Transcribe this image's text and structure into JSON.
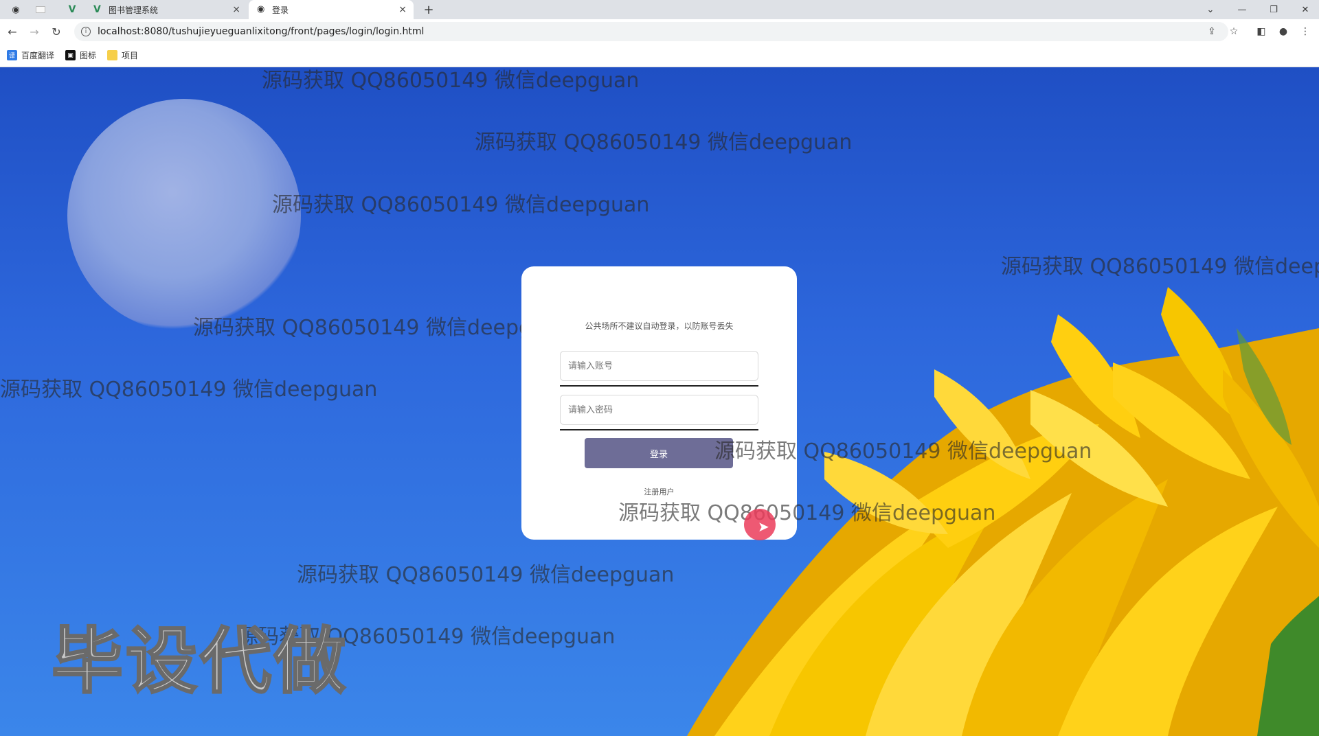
{
  "browser": {
    "tabs": [
      {
        "label": "图书管理系统",
        "close": "×"
      },
      {
        "label": "登录",
        "close": "×"
      }
    ],
    "new_tab": "+",
    "url": "localhost:8080/tushujieyueguanlixitong/front/pages/login/login.html",
    "bookmarks": [
      {
        "label": "百度翻译",
        "icon": "translate-icon"
      },
      {
        "label": "图标",
        "icon": "image-icon"
      },
      {
        "label": "项目",
        "icon": "folder-icon"
      }
    ]
  },
  "login": {
    "notice": "公共场所不建议自动登录，以防账号丢失",
    "account_placeholder": "请输入账号",
    "password_placeholder": "请输入密码",
    "login_label": "登录",
    "register_label": "注册用户"
  },
  "overlay": {
    "watermark": "源码获取 QQ86050149 微信deepguan",
    "watermark_truncated": "源码获取 QQ86050149 微信deep",
    "big_text": "毕设代做"
  },
  "colors": {
    "login_button": "#6e6d97",
    "sky": "#2d67dc",
    "petal": "#f5c400"
  }
}
